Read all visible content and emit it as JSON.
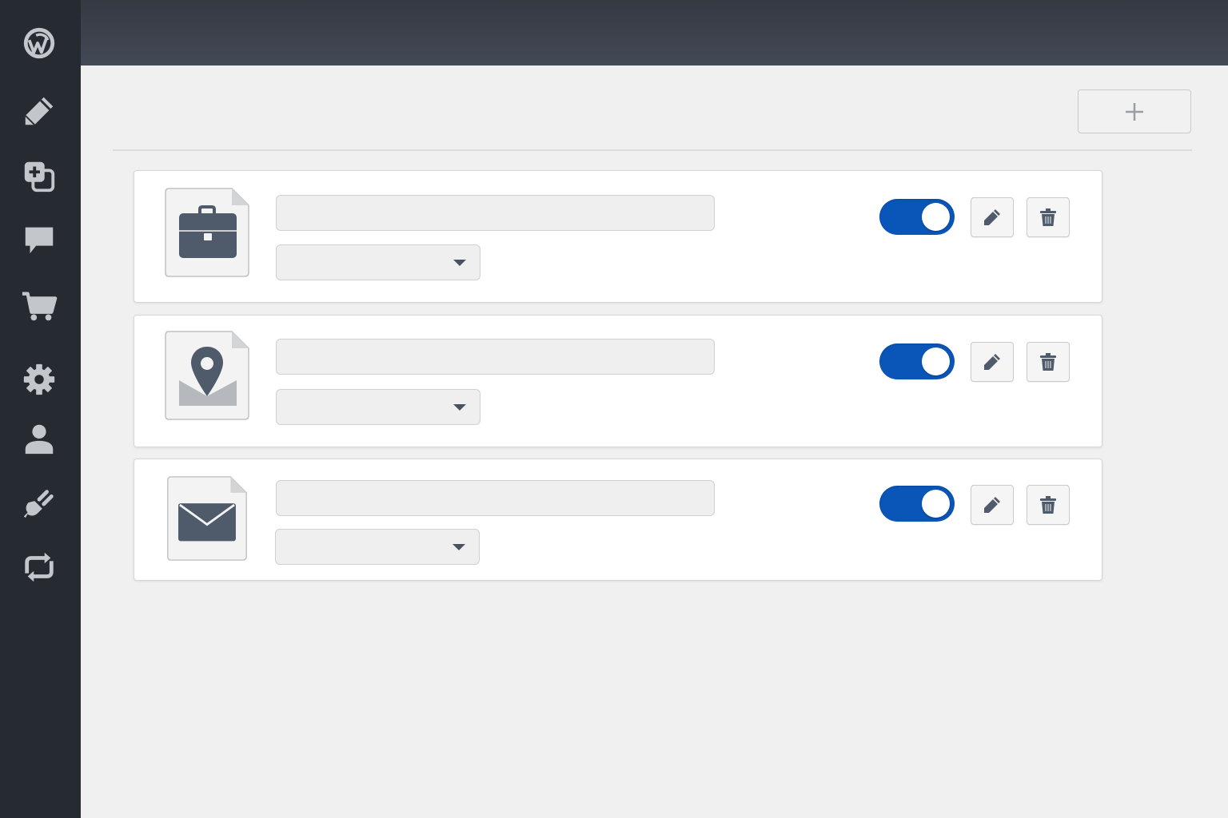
{
  "sidebar": {
    "items": [
      {
        "icon": "wordpress-logo-icon"
      },
      {
        "icon": "pencil-icon"
      },
      {
        "icon": "media-icon"
      },
      {
        "icon": "comment-icon"
      },
      {
        "icon": "cart-icon"
      },
      {
        "icon": "gear-icon"
      },
      {
        "icon": "user-icon"
      },
      {
        "icon": "plug-icon"
      },
      {
        "icon": "refresh-icon"
      }
    ]
  },
  "toolbar": {
    "add_icon": "plus-icon"
  },
  "rows": [
    {
      "thumbnail_icon": "briefcase-icon",
      "name_value": "",
      "type_value": "",
      "enabled": true,
      "edit_icon": "pencil-icon",
      "delete_icon": "trash-icon"
    },
    {
      "thumbnail_icon": "location-pin-icon",
      "name_value": "",
      "type_value": "",
      "enabled": true,
      "edit_icon": "pencil-icon",
      "delete_icon": "trash-icon"
    },
    {
      "thumbnail_icon": "envelope-icon",
      "name_value": "",
      "type_value": "",
      "enabled": true,
      "edit_icon": "pencil-icon",
      "delete_icon": "trash-icon"
    }
  ],
  "colors": {
    "sidebar_bg": "#262a31",
    "topbar_bg": "#3d424c",
    "accent": "#0a55b8",
    "icon_slate": "#4f5b6b",
    "page_bg": "#f0f0f1"
  }
}
